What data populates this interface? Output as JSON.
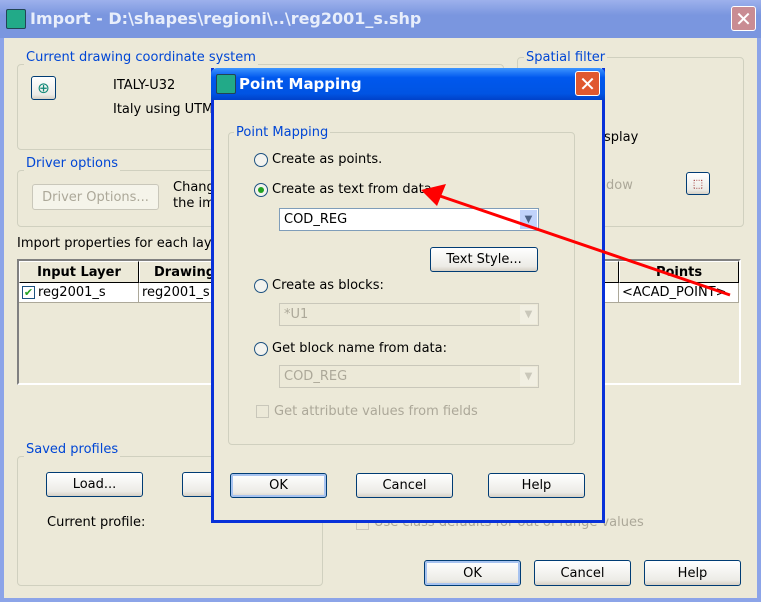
{
  "main": {
    "title": "Import - D:\\shapes\\regioni\\..\\reg2001_s.shp",
    "coord_group": {
      "label": "Current drawing coordinate system",
      "code": "ITALY-U32",
      "description": "Italy using UTM :"
    },
    "driver_group": {
      "label": "Driver options",
      "button": "Driver Options...",
      "text_line1": "Chang",
      "text_line2": "the imp"
    },
    "import_props_label": "Import properties for each layer i",
    "table": {
      "headers": [
        "Input Layer",
        "Drawing",
        "Points"
      ],
      "rows": [
        {
          "checked": true,
          "input_layer": "reg2001_s",
          "drawing": "reg2001_s",
          "points": "<ACAD_POINT>"
        }
      ]
    },
    "spatial_group": {
      "label": "Spatial filter",
      "display_text": "splay",
      "window_text": "dow"
    },
    "profiles_group": {
      "label": "Saved profiles",
      "load_button": "Load...",
      "current_profile_label": "Current profile:"
    },
    "class_defaults_checkbox": "Use class defaults for out of range values",
    "buttons": {
      "ok": "OK",
      "cancel": "Cancel",
      "help": "Help"
    }
  },
  "dialog": {
    "title": "Point Mapping",
    "group_label": "Point Mapping",
    "options": [
      {
        "label": "Create as points.",
        "selected": false
      },
      {
        "label": "Create as text from data",
        "selected": true
      },
      {
        "label": "Create as blocks:",
        "selected": false
      },
      {
        "label": "Get block name from data:",
        "selected": false
      }
    ],
    "text_field_combo": "COD_REG",
    "text_style_button": "Text Style...",
    "blocks_combo": "*U1",
    "block_name_combo": "COD_REG",
    "attribute_checkbox": {
      "label": "Get attribute values from fields",
      "checked": false,
      "enabled": false
    },
    "buttons": {
      "ok": "OK",
      "cancel": "Cancel",
      "help": "Help"
    }
  },
  "annotation": {
    "arrow_color": "#FF0000"
  },
  "colors": {
    "group_label": "#0046D5",
    "dialog_title": "#0054E3",
    "inactive_title": "#7A96DF"
  }
}
